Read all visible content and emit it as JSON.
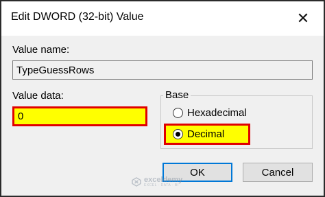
{
  "dialog": {
    "title": "Edit DWORD (32-bit) Value",
    "close_glyph": "✕"
  },
  "value_name": {
    "label": "Value name:",
    "value": "TypeGuessRows"
  },
  "value_data": {
    "label": "Value data:",
    "value": "0"
  },
  "base": {
    "title": "Base",
    "options": [
      {
        "label": "Hexadecimal",
        "selected": false
      },
      {
        "label": "Decimal",
        "selected": true
      }
    ]
  },
  "buttons": {
    "ok": "OK",
    "cancel": "Cancel"
  },
  "watermark": {
    "name": "exceldemy",
    "tagline": "EXCEL · DATA · BI"
  },
  "colors": {
    "highlight_fill": "#ffff00",
    "highlight_border": "#e00000",
    "focus_border": "#0078d7"
  }
}
